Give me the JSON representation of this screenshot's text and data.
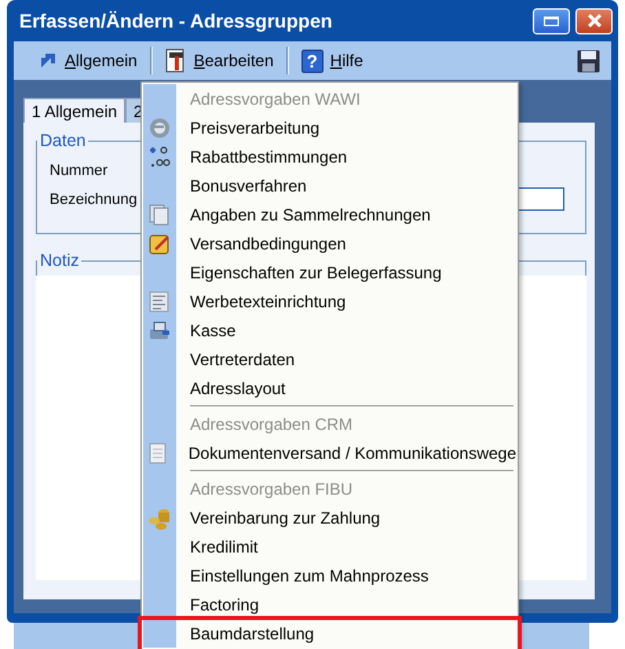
{
  "window": {
    "title": "Erfassen/Ändern - Adressgruppen"
  },
  "toolbar": [
    {
      "label": "Allgemein"
    },
    {
      "label": "Bearbeiten"
    },
    {
      "label": "Hilfe",
      "glyph": "?"
    }
  ],
  "tabs": [
    {
      "label": "1 Allgemein",
      "selected": true
    },
    {
      "label": "2",
      "selected": false
    }
  ],
  "groups": [
    {
      "title": "Daten",
      "fields": [
        {
          "label": "Nummer"
        },
        {
          "label": "Bezeichnung"
        }
      ]
    },
    {
      "title": "Notiz"
    }
  ],
  "menu": [
    {
      "kind": "header",
      "label": "Adressvorgaben WAWI"
    },
    {
      "kind": "item",
      "label": "Preisverarbeitung",
      "selected": false
    },
    {
      "kind": "item",
      "label": "Rabattbestimmungen",
      "selected": false
    },
    {
      "kind": "item",
      "label": "Bonusverfahren",
      "selected": false
    },
    {
      "kind": "item",
      "label": "Angaben zu Sammelrechnungen",
      "selected": false
    },
    {
      "kind": "item",
      "label": "Versandbedingungen",
      "selected": false
    },
    {
      "kind": "item",
      "label": "Eigenschaften zur Belegerfassung",
      "selected": false
    },
    {
      "kind": "item",
      "label": "Werbetexteinrichtung",
      "selected": false
    },
    {
      "kind": "item",
      "label": "Kasse",
      "selected": false
    },
    {
      "kind": "item",
      "label": "Vertreterdaten",
      "selected": false
    },
    {
      "kind": "item",
      "label": "Adresslayout",
      "selected": false
    },
    {
      "kind": "separator"
    },
    {
      "kind": "header",
      "label": "Adressvorgaben CRM"
    },
    {
      "kind": "item",
      "label": "Dokumentenversand / Kommunikationswege",
      "selected": false
    },
    {
      "kind": "separator"
    },
    {
      "kind": "header",
      "label": "Adressvorgaben FIBU"
    },
    {
      "kind": "item",
      "label": "Vereinbarung zur Zahlung",
      "selected": false
    },
    {
      "kind": "item",
      "label": "Kredilimit",
      "selected": false
    },
    {
      "kind": "item",
      "label": "Einstellungen zum Mahnprozess",
      "selected": false
    },
    {
      "kind": "item",
      "label": "Factoring",
      "selected": false
    },
    {
      "kind": "item",
      "label": "Baumdarstellung",
      "selected": true
    }
  ]
}
